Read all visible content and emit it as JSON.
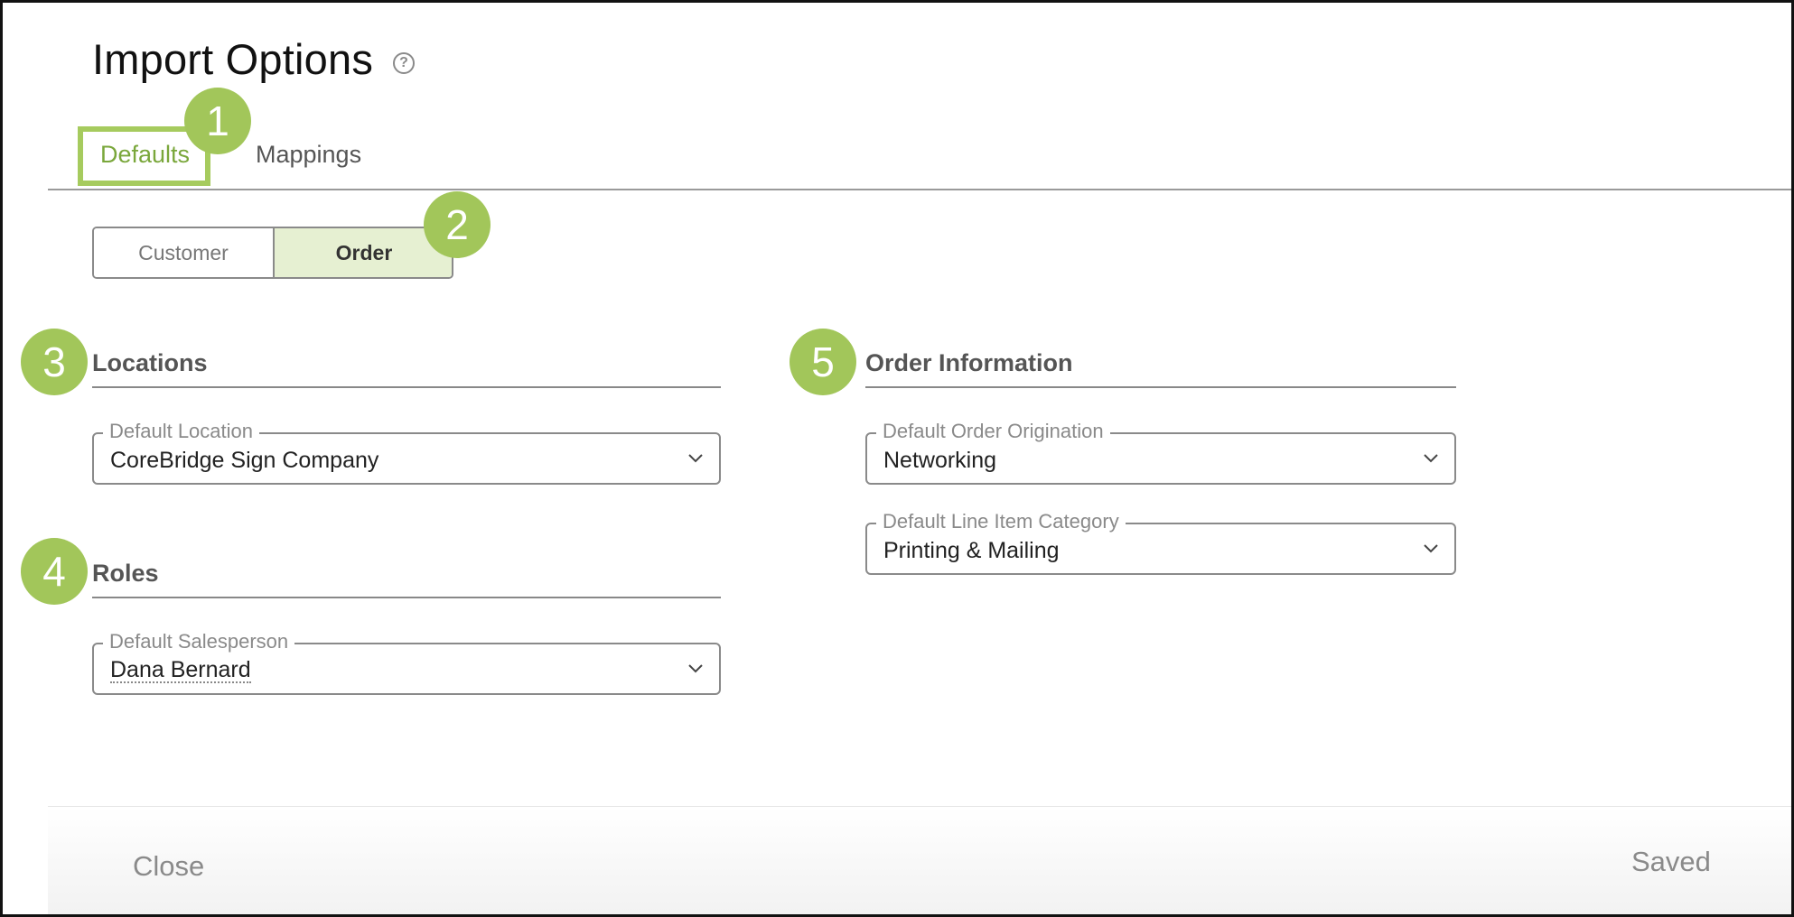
{
  "page": {
    "title": "Import Options",
    "help_icon": "question-circle-icon"
  },
  "tabs": [
    {
      "label": "Defaults",
      "active": true
    },
    {
      "label": "Mappings",
      "active": false
    }
  ],
  "toggle": {
    "options": [
      "Customer",
      "Order"
    ],
    "selected": "Order"
  },
  "sections": {
    "locations": {
      "title": "Locations",
      "fields": [
        {
          "label": "Default Location",
          "value": "CoreBridge Sign Company"
        }
      ]
    },
    "roles": {
      "title": "Roles",
      "fields": [
        {
          "label": "Default Salesperson",
          "value": "Dana Bernard"
        }
      ]
    },
    "order_information": {
      "title": "Order Information",
      "fields": [
        {
          "label": "Default Order Origination",
          "value": "Networking"
        },
        {
          "label": "Default Line Item Category",
          "value": "Printing & Mailing"
        }
      ]
    }
  },
  "callouts": [
    "1",
    "2",
    "3",
    "4",
    "5"
  ],
  "footer": {
    "close_label": "Close",
    "saved_label": "Saved"
  },
  "colors": {
    "accent": "#7aa73b",
    "callout": "#a2c65a",
    "toggle_selected_bg": "#e6f0d2"
  }
}
